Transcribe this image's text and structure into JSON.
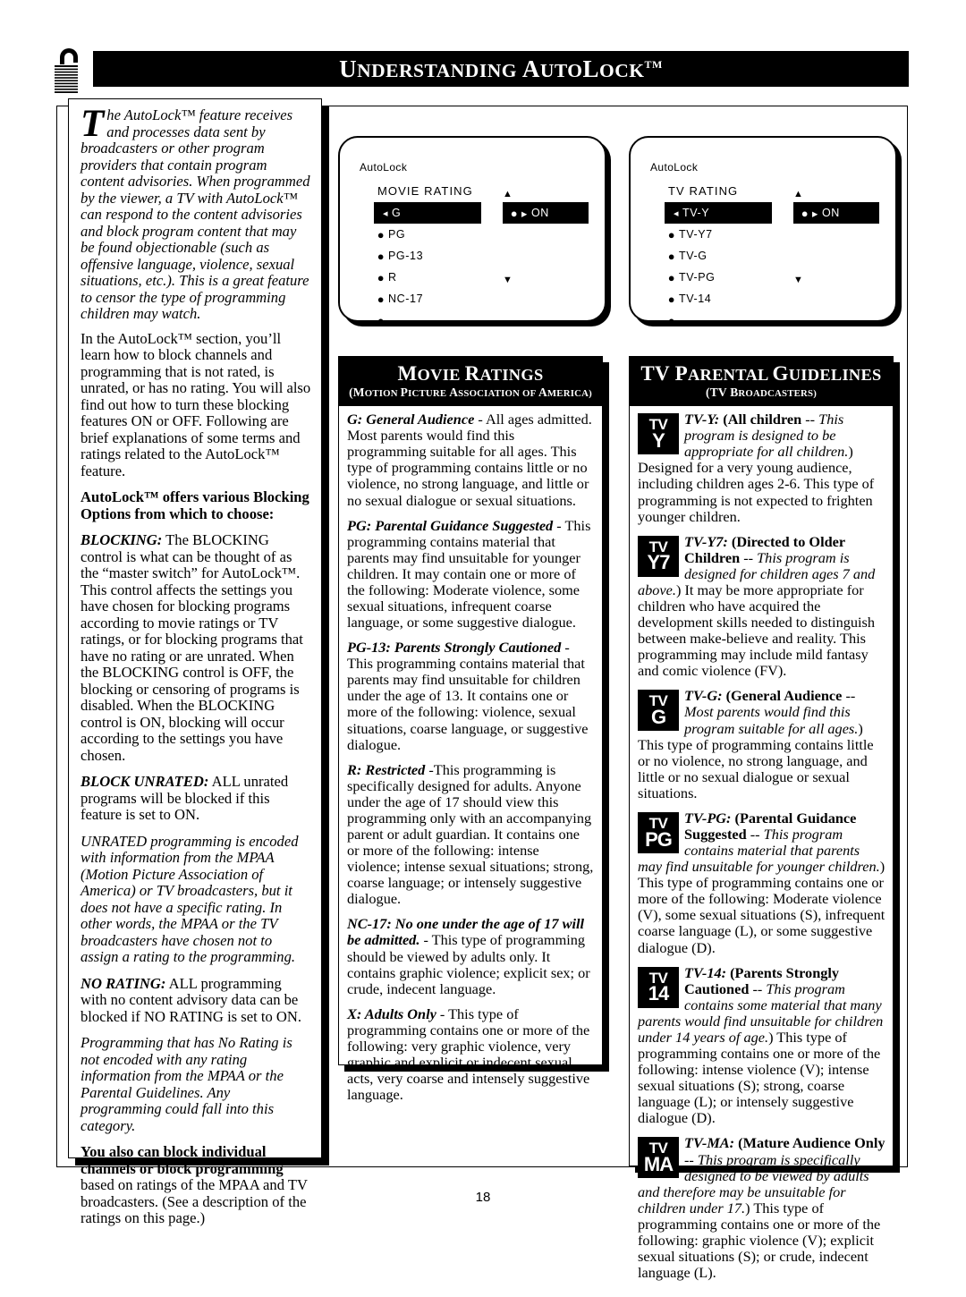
{
  "page": {
    "title_first": "U",
    "title_rest": "NDERSTANDING ",
    "title2_first": "A",
    "title2_rest": "UTO",
    "title3_first": "L",
    "title3_rest": "OCK",
    "title_tm": "TM",
    "lock_icon": "open-padlock-icon",
    "page_number": "18"
  },
  "left_column": {
    "dropcap": "T",
    "intro": "he AutoLock™ feature receives and processes data sent by broadcasters or other program providers that contain program content advisories. When programmed by the viewer, a TV with AutoLock™ can respond to the content advisories and block program content that may be found objectionable (such as offensive language, violence, sexual situations, etc.). This is a great feature to censor the type of programming children may watch.",
    "para2": "In the AutoLock™ section, you’ll learn how to block channels and programming that is not rated, is unrated, or has no rating. You will also find out how to turn these blocking features ON or OFF. Following are brief explanations of some terms and ratings related to the AutoLock™ feature.",
    "heading1": "AutoLock™ offers various Blocking Options from which to choose:",
    "blocking_label": "BLOCKING:",
    "blocking_text": " The BLOCKING control is what can be thought of as the “master switch” for AutoLock™. This control affects the settings you have chosen for blocking programs according to movie ratings or TV ratings, or for blocking programs that have no rating or are unrated. When the BLOCKING control is OFF, the blocking or censoring of programs is disabled. When the BLOCKING control is ON, blocking will occur according to the settings you have chosen.",
    "block_unrated_label": "BLOCK UNRATED:",
    "block_unrated_text": " ALL unrated programs will be blocked if this feature is set to ON.",
    "unrated_note": "UNRATED programming is encoded with information from the MPAA (Motion Picture Association of America) or TV broadcasters, but it does not have a specific rating. In other words, the MPAA or the TV broadcasters have chosen not to assign a rating to the programming.",
    "no_rating_label": "NO RATING:",
    "no_rating_text": " ALL programming with no content advisory data can be blocked if NO RATING is set to ON.",
    "no_rating_note": "Programming that has No Rating is not encoded with any rating information from the MPAA or the Parental Guidelines. Any programming could fall into this category.",
    "final_bold": "You also can block individual channels or block programming",
    "final_rest": " based on ratings of the MPAA and TV broadcasters. (See a description of the ratings on this page.)"
  },
  "screen_movie": {
    "app_label": "AutoLock",
    "header": "MOVIE  RATING",
    "selected": "G",
    "items": [
      "PG",
      "PG-13",
      "R",
      "NC-17",
      ""
    ],
    "on_label": "ON",
    "up_arrow": "▲",
    "down_arrow": "▼",
    "left_caret": "◂",
    "bullet": "●",
    "right_caret": "▸"
  },
  "screen_tv": {
    "app_label": "AutoLock",
    "header": "TV  RATING",
    "selected": "TV-Y",
    "items": [
      "TV-Y7",
      "TV-G",
      "TV-PG",
      "TV-14",
      ""
    ],
    "on_label": "ON",
    "up_arrow": "▲",
    "down_arrow": "▼",
    "left_caret": "◂",
    "bullet": "●",
    "right_caret": "▸"
  },
  "movie_panel": {
    "title_first": "M",
    "title_rest": "OVIE ",
    "title2_first": "R",
    "title2_rest": "ATINGS",
    "sub_parts": [
      {
        "f": "(M",
        "r": "OTION "
      },
      {
        "f": "P",
        "r": "ICTURE "
      },
      {
        "f": "A",
        "r": "SSOCIATION OF "
      },
      {
        "f": "A",
        "r": "MERICA)"
      }
    ],
    "entries": [
      {
        "label": "G: General Audience",
        "text": " - All ages admitted. Most parents would find this programming suitable for all ages. This type of programming contains little or no violence, no strong language, and little or no sexual dialogue or sexual situations."
      },
      {
        "label": "PG: Parental Guidance Suggested",
        "text": " - This programming contains material that parents may find unsuitable for younger children. It may contain one or more of the following: Moderate violence, some sexual situations, infrequent coarse language, or some suggestive dialogue."
      },
      {
        "label": "PG-13: Parents Strongly Cautioned",
        "text": " - This programming contains material that parents may find unsuitable for children under the age of 13. It contains one or more of the following: violence, sexual situations, coarse language, or suggestive dialogue."
      },
      {
        "label": "R: Restricted",
        "text": " -This programming is specifically designed for adults.  Anyone under the age of 17 should view this programming only with an accompanying parent or adult guardian. It contains one or more of the following: intense violence; intense sexual situations; strong, coarse language; or intensely suggestive dialogue."
      },
      {
        "label": "NC-17: No one under the age of 17 will be admitted.",
        "text": " - This type of programming should be viewed by adults only. It contains graphic violence; explicit sex; or crude, indecent language."
      },
      {
        "label": "X: Adults Only",
        "text": " - This type of programming contains one or more of the following: very graphic violence, very graphic and explicit or indecent sexual acts, very coarse and intensely suggestive language."
      }
    ]
  },
  "tv_panel": {
    "title_first": "TV ",
    "title_p2f": "P",
    "title_p2r": "ARENTAL ",
    "title_p3f": "G",
    "title_p3r": "UIDELINES",
    "sub_f1": "(TV ",
    "sub_f2": "B",
    "sub_r2": "ROADCASTERS)",
    "entries": [
      {
        "icon_top": "TV",
        "icon_bottom": "Y",
        "name": "TV-Y:",
        "bold1": " (All children",
        "ital1": " -- This program is designed to be appropriate for all children.",
        "rest": ") Designed for a very young audience, including children ages 2-6. This type of programming is not expected to frighten younger children."
      },
      {
        "icon_top": "TV",
        "icon_bottom": "Y7",
        "name": "TV-Y7:",
        "bold1": " (Directed to Older Children",
        "ital1": " -- This program is designed for children ages 7 and above.",
        "rest": ") It may be more appropriate for children who have acquired the development skills needed to distinguish between make-believe and reality. This programming may include mild fantasy and comic violence (FV)."
      },
      {
        "icon_top": "TV",
        "icon_bottom": "G",
        "name": "TV-G:",
        "bold1": " (General Audience",
        "ital1": " -- Most parents would find this program suitable for all ages.",
        "rest": ") This type of programming contains little or no violence, no strong language, and little or no sexual dialogue or sexual situations."
      },
      {
        "icon_top": "TV",
        "icon_bottom": "PG",
        "name": "TV-PG:",
        "bold1": " (Parental Guidance Suggested",
        "ital1": " -- This program contains material that parents may find unsuitable for younger children.",
        "rest": ") This type of programming contains one or more of the following: Moderate violence (V), some sexual situations (S), infrequent coarse language (L), or some suggestive dialogue (D)."
      },
      {
        "icon_top": "TV",
        "icon_bottom": "14",
        "name": "TV-14:",
        "bold1": " (Parents Strongly Cautioned",
        "ital1": " -- This program contains some material that many parents would find unsuitable for children under 14 years of age.",
        "rest": ") This type of programming contains one or more of the following: intense violence (V); intense sexual situations (S); strong, coarse language (L); or intensely suggestive dialogue (D)."
      },
      {
        "icon_top": "TV",
        "icon_bottom": "MA",
        "name": "TV-MA:",
        "bold1": " (Mature Audience Only",
        "ital1": " -- This program is specifically designed to be viewed by adults and therefore may be unsuitable for children under 17.",
        "rest": ") This type of programming contains one or more of the following: graphic violence (V); explicit sexual situations (S); or crude, indecent language (L)."
      }
    ]
  }
}
